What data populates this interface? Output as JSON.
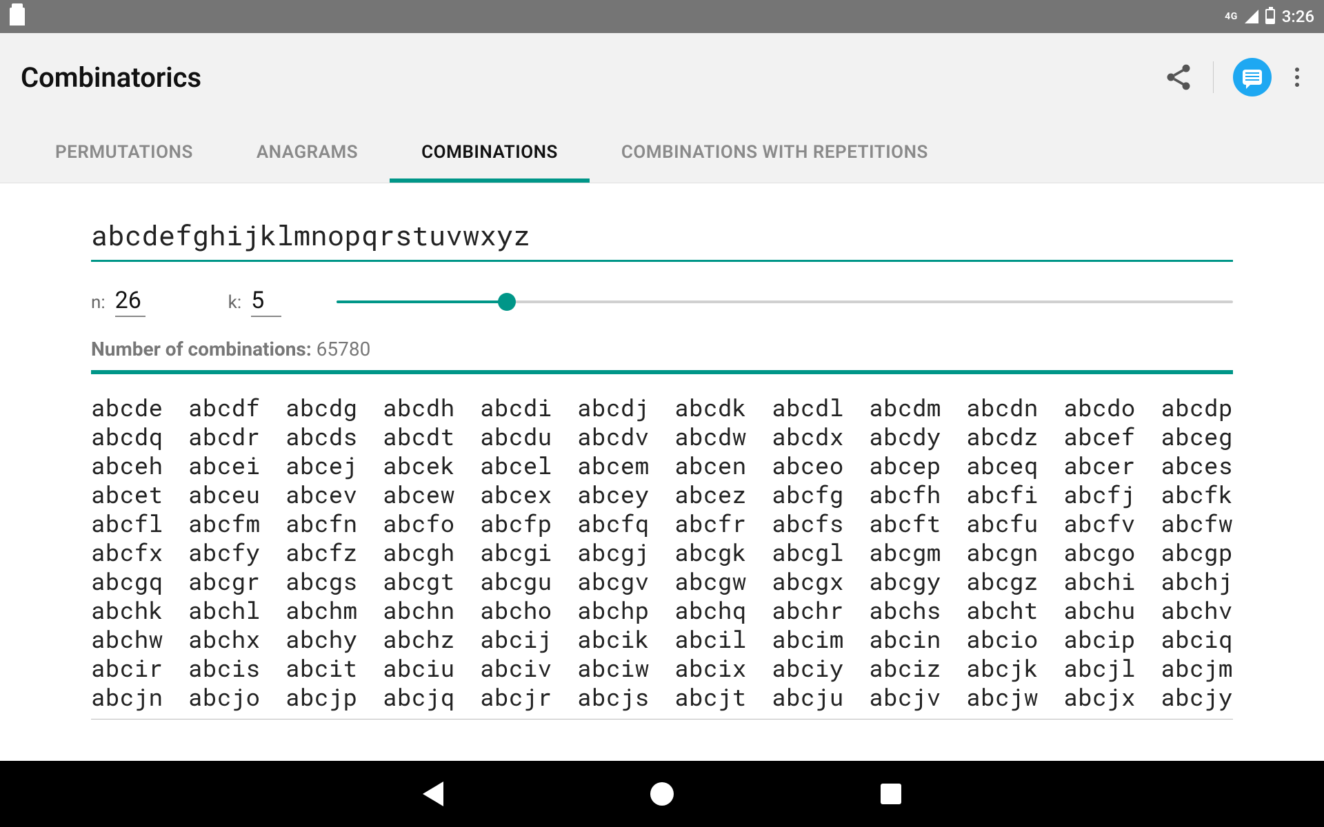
{
  "status": {
    "network_label": "4G",
    "time": "3:26"
  },
  "appbar": {
    "title": "Combinatorics"
  },
  "tabs": [
    {
      "label": "PERMUTATIONS",
      "active": false
    },
    {
      "label": "ANAGRAMS",
      "active": false
    },
    {
      "label": "COMBINATIONS",
      "active": true
    },
    {
      "label": "COMBINATIONS WITH REPETITIONS",
      "active": false
    }
  ],
  "input": {
    "value": "abcdefghijklmnopqrstuvwxyz"
  },
  "params": {
    "n_label": "n:",
    "n_value": "26",
    "k_label": "k:",
    "k_value": "5",
    "slider_percent": 19
  },
  "count": {
    "label": "Number of combinations:",
    "value": "65780"
  },
  "results_rows": [
    [
      "abcde",
      "abcdf",
      "abcdg",
      "abcdh",
      "abcdi",
      "abcdj",
      "abcdk",
      "abcdl",
      "abcdm",
      "abcdn",
      "abcdo",
      "abcdp"
    ],
    [
      "abcdq",
      "abcdr",
      "abcds",
      "abcdt",
      "abcdu",
      "abcdv",
      "abcdw",
      "abcdx",
      "abcdy",
      "abcdz",
      "abcef",
      "abceg"
    ],
    [
      "abceh",
      "abcei",
      "abcej",
      "abcek",
      "abcel",
      "abcem",
      "abcen",
      "abceo",
      "abcep",
      "abceq",
      "abcer",
      "abces"
    ],
    [
      "abcet",
      "abceu",
      "abcev",
      "abcew",
      "abcex",
      "abcey",
      "abcez",
      "abcfg",
      "abcfh",
      "abcfi",
      "abcfj",
      "abcfk"
    ],
    [
      "abcfl",
      "abcfm",
      "abcfn",
      "abcfo",
      "abcfp",
      "abcfq",
      "abcfr",
      "abcfs",
      "abcft",
      "abcfu",
      "abcfv",
      "abcfw"
    ],
    [
      "abcfx",
      "abcfy",
      "abcfz",
      "abcgh",
      "abcgi",
      "abcgj",
      "abcgk",
      "abcgl",
      "abcgm",
      "abcgn",
      "abcgo",
      "abcgp"
    ],
    [
      "abcgq",
      "abcgr",
      "abcgs",
      "abcgt",
      "abcgu",
      "abcgv",
      "abcgw",
      "abcgx",
      "abcgy",
      "abcgz",
      "abchi",
      "abchj"
    ],
    [
      "abchk",
      "abchl",
      "abchm",
      "abchn",
      "abcho",
      "abchp",
      "abchq",
      "abchr",
      "abchs",
      "abcht",
      "abchu",
      "abchv"
    ],
    [
      "abchw",
      "abchx",
      "abchy",
      "abchz",
      "abcij",
      "abcik",
      "abcil",
      "abcim",
      "abcin",
      "abcio",
      "abcip",
      "abciq"
    ],
    [
      "abcir",
      "abcis",
      "abcit",
      "abciu",
      "abciv",
      "abciw",
      "abcix",
      "abciy",
      "abciz",
      "abcjk",
      "abcjl",
      "abcjm"
    ],
    [
      "abcjn",
      "abcjo",
      "abcjp",
      "abcjq",
      "abcjr",
      "abcjs",
      "abcjt",
      "abcju",
      "abcjv",
      "abcjw",
      "abcjx",
      "abcjy"
    ]
  ]
}
